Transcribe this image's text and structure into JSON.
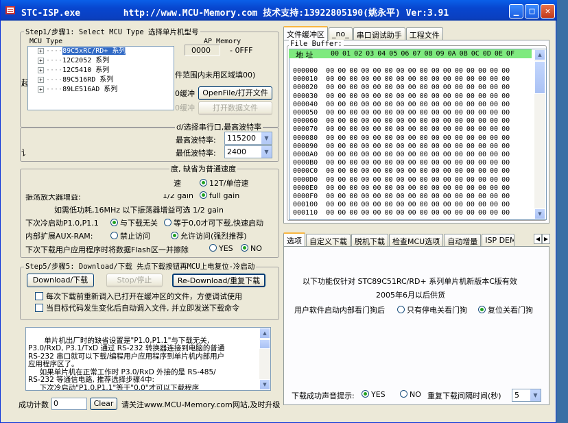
{
  "window": {
    "title": "STC-ISP.exe        http://www.MCU-Memory.com 技术支持:13922805190(姚永平) Ver:3.91"
  },
  "step1": {
    "label": "Step1/步骤1: Select MCU Type  选择单片机型号",
    "mcu_type_label": "MCU Type",
    "ap_memory_label": "AP Memory",
    "ap_start": "0000",
    "ap_end": "- 0FFF",
    "tree": [
      {
        "label": "89C5xRC/RD+ 系列",
        "selected": true
      },
      {
        "label": "12C2052 系列"
      },
      {
        "label": "12C5410 系列"
      },
      {
        "label": "89C516RD 系列"
      },
      {
        "label": "89LE516AD 系列"
      }
    ]
  },
  "step2": {
    "partial_label": "件范围内未用区域填00)",
    "frag_a": "0缓冲",
    "frag_b": "0缓冲",
    "open_file": "OpenFile/打开文件",
    "open_data": "打开数据文件",
    "frag_left": "起"
  },
  "step3": {
    "label_partial": "d/选择串行口,最高波特率",
    "max_baud_label": "最高波特率:",
    "max_baud": "115200",
    "min_baud_label": "最低波特率:",
    "min_baud": "2400",
    "frag_left": "讠"
  },
  "step4": {
    "label_partial": "度, 缺省为普通速度",
    "speed_frag": "速",
    "speed_12t": "12T/单倍速",
    "gain_frag": "1/2 gain",
    "gain_prefix": "振荡放大器增益:",
    "full_gain": "full gain",
    "lowpower_note": "如需低功耗,16MHz 以下振荡器增益可选 1/2 gain",
    "cold_start_label": "下次冷启动P1.0,P1.1",
    "cold_opt1": "与下载无关",
    "cold_opt2": "等于0,0才可下载,快速启动",
    "auxram_label": "内部扩展AUX-RAM:",
    "aux_opt1": "禁止访问",
    "aux_opt2": "允许访问(强烈推荐)",
    "erase_label": "下次下载用户应用程序时将数据Flash区一并擦除",
    "erase_yes": "YES",
    "erase_no": "NO"
  },
  "step5": {
    "label": "Step5/步骤5: Download/下载  先点下载按钮再MCU上电复位-冷启动",
    "download": "Download/下载",
    "stop": "Stop/停止",
    "redownload": "Re-Download/重复下载",
    "check1": "每次下载前重新调入已打开在缓冲区的文件，方便调试使用",
    "check2": "当目标代码发生变化后自动调入文件, 并立即发送下载命令"
  },
  "memo": {
    "text": "     单片机出厂时的缺省设置是\"P1.0,P1.1\"与下载无关,\nP3.0/RxD, P3.1/TxD 通过 RS-232 转换器连接到电脑的普通\nRS-232 串口就可以下载/编程用户应用程序到单片机内部用户\n应用程序区了。\n     如果单片机在正常工作时 P3.0/RxD 外接的是 RS-485/\nRS-232 等通信电路, 推荐选择步骤4中:\n     下次冷启动\"P1.0,P1.1\"等于\"0,0\"才可以下载程序"
  },
  "status": {
    "success_label": "成功计数",
    "success_value": "0",
    "clear": "Clear",
    "notice": "请关注www.MCU-Memory.com网站,及时升级"
  },
  "right_top": {
    "tabs": [
      "文件缓冲区",
      "_no_",
      "串口调试助手",
      "工程文件"
    ],
    "file_buffer_label": "File Buffer:",
    "addr_header": "地  址",
    "col_headers": "00 01 02 03 04 05 06 07 08 09 0A 0B 0C 0D 0E 0F",
    "rows": [
      "000000",
      "000010",
      "000020",
      "000030",
      "000040",
      "000050",
      "000060",
      "000070",
      "000080",
      "000090",
      "0000A0",
      "0000B0",
      "0000C0",
      "0000D0",
      "0000E0",
      "0000F0",
      "000100",
      "000110"
    ],
    "row_data": "00 00 00 00 00 00 00 00 00 00 00 00 00 00 00 00"
  },
  "right_bottom": {
    "tabs": [
      "选项",
      "自定义下载",
      "脱机下载",
      "检查MCU选项",
      "自动增量",
      "ISP DEMO"
    ],
    "note1": "以下功能仅针对 STC89C51RC/RD+ 系列单片机新版本C版有效",
    "note2": "2005年6月以后供货",
    "watchdog_label": "用户软件启动内部看门狗后",
    "wd_opt1": "只有停电关看门狗",
    "wd_opt2": "复位关看门狗",
    "sound_label": "下载成功声音提示:",
    "sound_yes": "YES",
    "sound_no": "NO",
    "interval_label": "重复下载间隔时间(秒)",
    "interval": "5"
  }
}
